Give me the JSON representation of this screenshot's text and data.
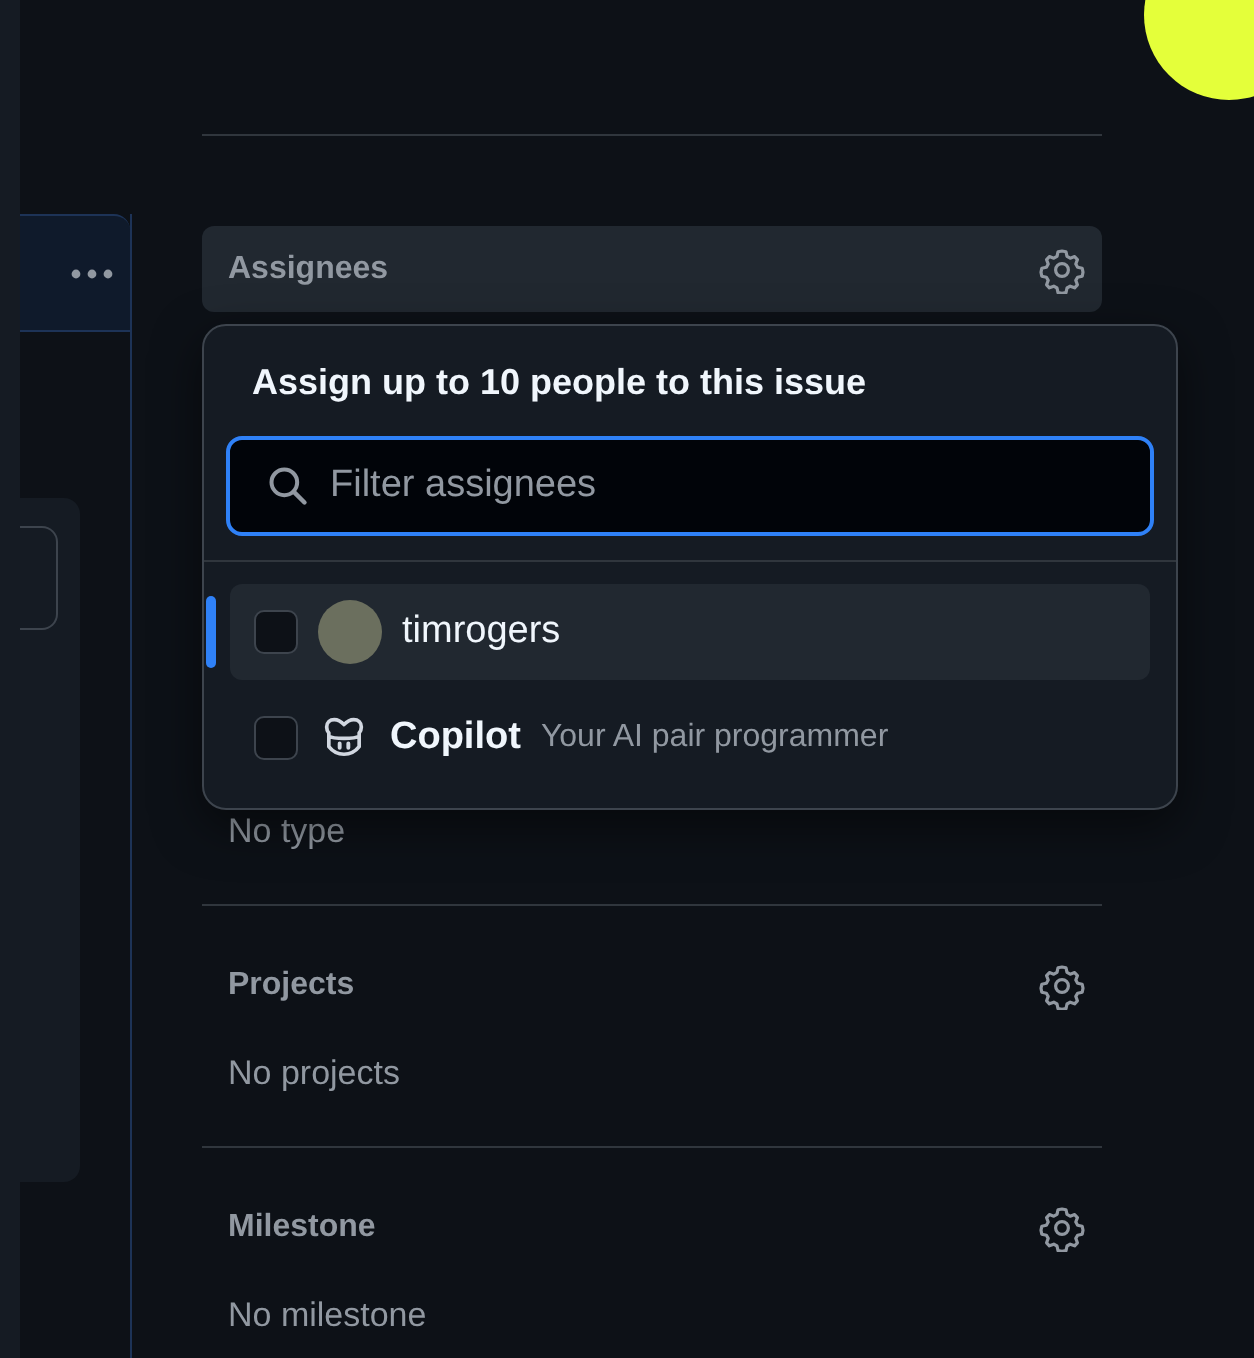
{
  "sidebar": {
    "assignees": {
      "title": "Assignees"
    },
    "sections": [
      {
        "value": "No type"
      },
      {
        "title": "Projects",
        "value": "No projects"
      },
      {
        "title": "Milestone",
        "value": "No milestone"
      }
    ]
  },
  "assign_popover": {
    "title": "Assign up to 10 people to this issue",
    "search": {
      "placeholder": "Filter assignees"
    },
    "options": [
      {
        "kind": "user",
        "name": "timrogers",
        "selected": true,
        "checked": false
      },
      {
        "kind": "bot",
        "name": "Copilot",
        "description": "Your AI pair programmer",
        "selected": false,
        "checked": false
      }
    ]
  }
}
